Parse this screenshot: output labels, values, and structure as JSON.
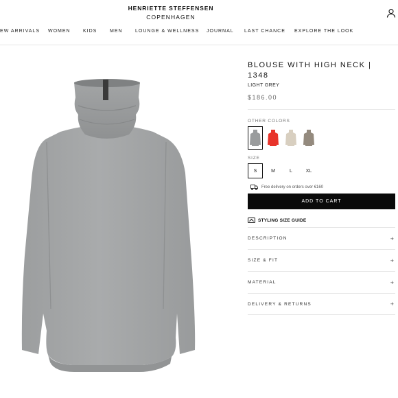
{
  "header": {
    "brand": "HENRIETTE STEFFENSEN",
    "city": "COPENHAGEN",
    "user_icon": "user-icon"
  },
  "nav": [
    {
      "label": "NEW ARRIVALS"
    },
    {
      "label": "WOMEN"
    },
    {
      "label": "KIDS"
    },
    {
      "label": "MEN"
    },
    {
      "label": "LOUNGE & WELLNESS"
    },
    {
      "label": "JOURNAL"
    },
    {
      "label": "LAST CHANCE"
    },
    {
      "label": "EXPLORE THE LOOK"
    }
  ],
  "product": {
    "title": "BLOUSE WITH HIGH NECK | 1348",
    "color_name": "LIGHT GREY",
    "price": "$186.00",
    "other_colors_label": "OTHER COLORS",
    "colors": [
      {
        "name": "light-grey",
        "hex": "#9a9c9d",
        "selected": true
      },
      {
        "name": "red",
        "hex": "#e8342b",
        "selected": false
      },
      {
        "name": "cream",
        "hex": "#d8cfc0",
        "selected": false
      },
      {
        "name": "taupe",
        "hex": "#948a7e",
        "selected": false
      }
    ],
    "size_label": "SIZE",
    "sizes": [
      {
        "label": "S",
        "selected": true
      },
      {
        "label": "M",
        "selected": false
      },
      {
        "label": "L",
        "selected": false
      },
      {
        "label": "XL",
        "selected": false
      }
    ],
    "delivery_note": "Free delivery on orders over €160",
    "delivery_icon": "truck-icon",
    "add_to_cart": "ADD TO CART",
    "styling_guide": "STYLING SIZE GUIDE",
    "styling_icon": "hanger-icon",
    "accordion": [
      {
        "label": "DESCRIPTION",
        "icon": "+"
      },
      {
        "label": "SIZE & FIT",
        "icon": "+"
      },
      {
        "label": "MATERIAL",
        "icon": "+"
      },
      {
        "label": "DELIVERY & RETURNS",
        "icon": "+"
      }
    ]
  }
}
